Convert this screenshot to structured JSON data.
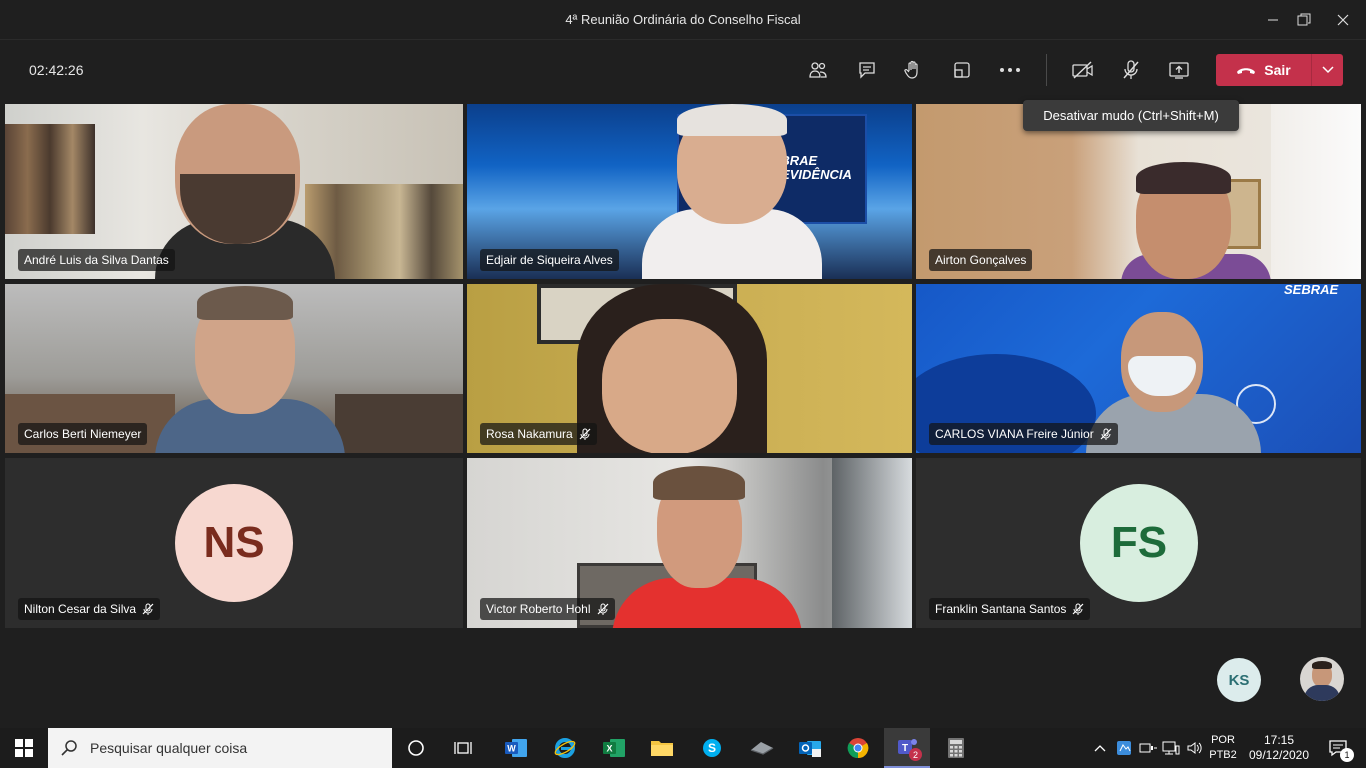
{
  "window": {
    "title": "4ª Reunião Ordinária do Conselho Fiscal"
  },
  "toolbar": {
    "timer": "02:42:26",
    "leave_label": "Sair",
    "tooltip": "Desativar mudo (Ctrl+Shift+M)"
  },
  "participants": [
    {
      "name": "André Luis da Silva Dantas",
      "muted": false
    },
    {
      "name": "Edjair de Siqueira Alves",
      "muted": false
    },
    {
      "name": "Airton Gonçalves",
      "muted": false
    },
    {
      "name": "Carlos Berti Niemeyer",
      "muted": false
    },
    {
      "name": "Rosa Nakamura",
      "muted": true
    },
    {
      "name": "CARLOS VIANA Freire Júnior",
      "muted": true
    },
    {
      "name": "Nilton Cesar da Silva",
      "muted": true,
      "initials": "NS"
    },
    {
      "name": "Victor Roberto Hohl",
      "muted": true
    },
    {
      "name": "Franklin Santana Santos",
      "muted": true,
      "initials": "FS"
    }
  ],
  "backgrounds": {
    "sebrae_line1": "SEBRAE",
    "sebrae_line2": "PREVIDÊNCIA",
    "sebrae_corner": "SEBRAE"
  },
  "self_view": {
    "initials": "KS"
  },
  "taskbar": {
    "search_placeholder": "Pesquisar qualquer coisa",
    "teams_badge": "2",
    "lang_line1": "POR",
    "lang_line2": "PTB2",
    "time": "17:15",
    "date": "09/12/2020",
    "notification_count": "1"
  },
  "colors": {
    "leave_red": "#c4314b",
    "ns_avatar_bg": "#f7d8d0",
    "ns_avatar_fg": "#7a2c1e",
    "fs_avatar_bg": "#d8eedf",
    "fs_avatar_fg": "#1d6b3a",
    "ks_avatar_bg": "#dcecec",
    "ks_avatar_fg": "#2b6f73"
  }
}
